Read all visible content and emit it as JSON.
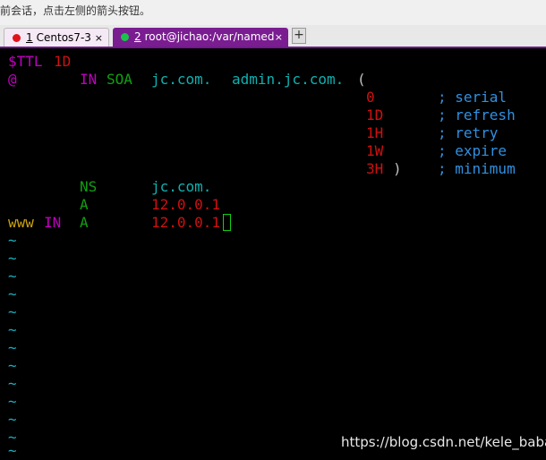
{
  "notice": {
    "text": "前会话，点击左侧的箭头按钮。"
  },
  "tabs": [
    {
      "number": "1",
      "label": "Centos7-3",
      "close": "×",
      "color": "#e0141e"
    },
    {
      "number": "2",
      "label": "root@jichao:/var/named",
      "close": "×",
      "color": "#19c34a"
    }
  ],
  "new_tab": {
    "label": "+"
  },
  "editor": {
    "line1": {
      "var": "$TTL",
      "val": "1D"
    },
    "line2": {
      "at": "@",
      "in": "IN",
      "soa": "SOA",
      "ns": "jc.com.",
      "admin": "admin.jc.com.",
      "paren": "("
    },
    "serial": {
      "num": "0",
      "comment": "; serial"
    },
    "refresh": {
      "num": "1D",
      "comment": "; refresh"
    },
    "retry": {
      "num": "1H",
      "comment": "; retry"
    },
    "expire": {
      "num": "1W",
      "comment": "; expire"
    },
    "minimum": {
      "num": "3H",
      "paren": ")",
      "comment": "; minimum"
    },
    "ns_record": {
      "type": "NS",
      "value": "jc.com."
    },
    "a_record": {
      "type": "A",
      "value": "12.0.0.1"
    },
    "www_record": {
      "host": "www",
      "in": "IN",
      "type": "A",
      "value": "12.0.0.1"
    },
    "tilde": "~"
  },
  "watermark": {
    "text": "https://blog.csdn.net/kele_baba"
  }
}
